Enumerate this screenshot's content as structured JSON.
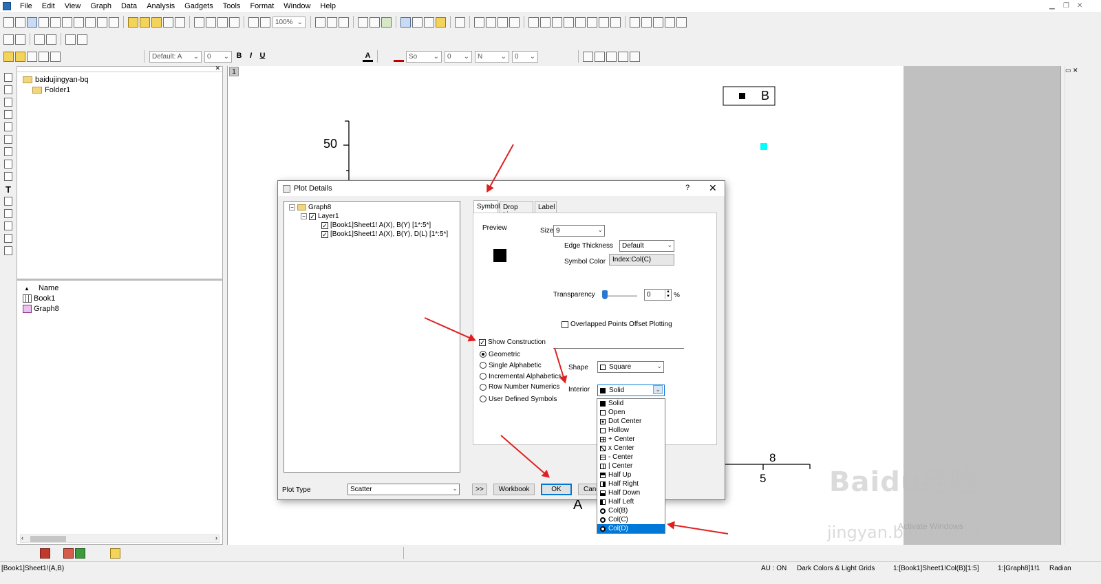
{
  "menu": [
    "File",
    "Edit",
    "View",
    "Graph",
    "Data",
    "Analysis",
    "Gadgets",
    "Tools",
    "Format",
    "Window",
    "Help"
  ],
  "toolbar": {
    "zoom": "100%",
    "font_name": "Default: A",
    "font_size": "0",
    "line_style": "So",
    "line_width": "0",
    "fill_label": "N",
    "fill_value": "0"
  },
  "explorer": {
    "root": "baidujingyan-bq",
    "folder": "Folder1",
    "name_header": "Name",
    "files": [
      "Book1",
      "Graph8"
    ]
  },
  "graph": {
    "layer_tab": "1",
    "y_tick": "50",
    "x_tick": "5",
    "x_tick_top": "8",
    "x_label": "A",
    "legend_label": "B"
  },
  "dialog": {
    "title": "Plot Details",
    "help": "?",
    "close": "✕",
    "tree": {
      "root": "Graph8",
      "layer": "Layer1",
      "plot1": "[Book1]Sheet1! A(X), B(Y) [1*:5*]",
      "plot2": "[Book1]Sheet1! A(X), B(Y), D(L) [1*:5*]"
    },
    "tabs": [
      "Symbol",
      "Drop Lines",
      "Label"
    ],
    "symbol": {
      "preview": "Preview",
      "size_label": "Size",
      "size_value": "9",
      "edge_label": "Edge Thickness",
      "edge_value": "Default",
      "color_label": "Symbol Color",
      "color_value": "Index:Col(C)",
      "transparency_label": "Transparency",
      "transparency_value": "0",
      "percent": "%",
      "overlap_label": "Overlapped Points Offset Plotting",
      "show_construction": "Show Construction",
      "radios": [
        "Geometric",
        "Single Alphabetic",
        "Incremental Alphabetics",
        "Row Number Numerics",
        "User Defined Symbols"
      ],
      "shape_label": "Shape",
      "shape_value": "Square",
      "interior_label": "Interior",
      "interior_value": "Solid",
      "interior_options": [
        "Solid",
        "Open",
        "Dot Center",
        "Hollow",
        "+ Center",
        "x Center",
        "- Center",
        "| Center",
        "Half Up",
        "Half Right",
        "Half Down",
        "Half Left",
        "Col(B)",
        "Col(C)",
        "Col(D)"
      ]
    },
    "plot_type_label": "Plot Type",
    "plot_type_value": "Scatter",
    "buttons": {
      "more": ">>",
      "workbook": "Workbook",
      "ok": "OK",
      "cancel": "Cancel"
    }
  },
  "status": {
    "left": "[Book1]Sheet1!(A,B)",
    "au": "AU : ON",
    "theme": "Dark Colors & Light Grids",
    "active_col": "1:[Book1]Sheet1!Col(B)[1:5]",
    "active_graph": "1:[Graph8]1!1",
    "angle": "Radian"
  },
  "watermark": {
    "brand": "Baidu经验",
    "url": "jingyan.baidu.com",
    "activate": "Activate Windows"
  },
  "colors": {
    "accent": "#0078d7",
    "arrow": "#e02020",
    "cyan_point": "#00ffff"
  }
}
